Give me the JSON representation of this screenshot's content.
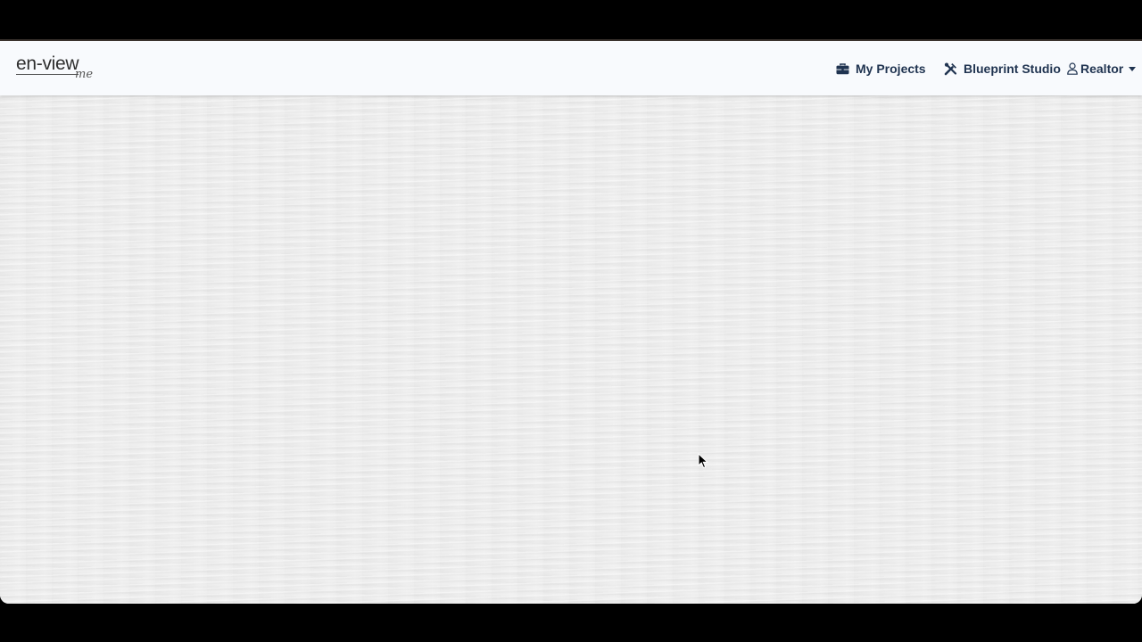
{
  "brand": {
    "name": "en-view",
    "sub": "me"
  },
  "nav": {
    "projects_label": "My Projects",
    "projects_icon": "briefcase-icon",
    "blueprint_label": "Blueprint Studio",
    "blueprint_icon": "tools-icon",
    "user_label": "Realtor",
    "user_icon": "person-icon"
  },
  "colors": {
    "nav_text": "#1f3350",
    "navbar_bg": "#f8fafd",
    "content_bg": "#ececec",
    "frame": "#000000"
  }
}
